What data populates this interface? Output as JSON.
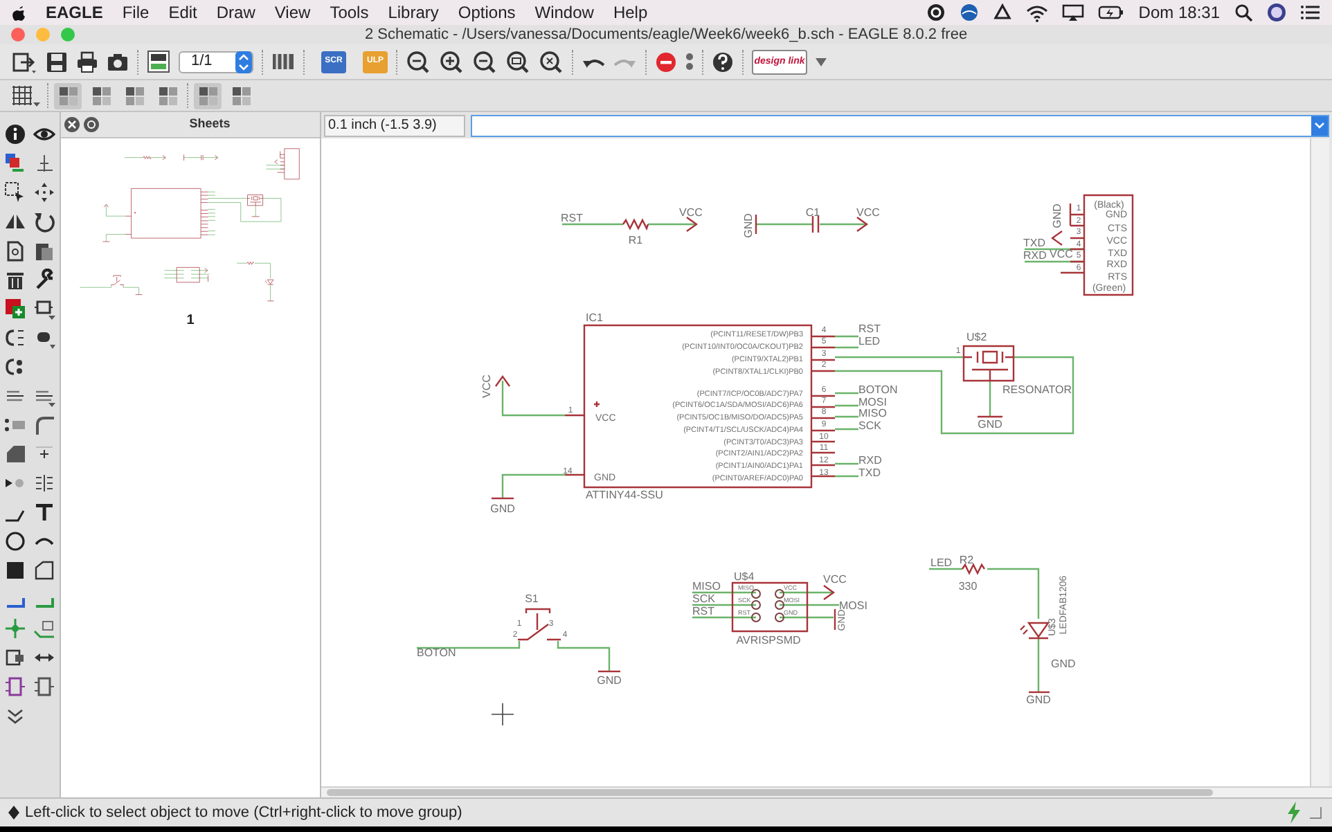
{
  "menubar": {
    "app": "EAGLE",
    "items": [
      "File",
      "Edit",
      "Draw",
      "View",
      "Tools",
      "Library",
      "Options",
      "Window",
      "Help"
    ],
    "clock": "Dom 18:31"
  },
  "window": {
    "title": "2 Schematic - /Users/vanessa/Documents/eagle/Week6/week6_b.sch - EAGLE 8.0.2 free"
  },
  "toolbar": {
    "sheet_select": "1/1",
    "script_label": "SCR",
    "ulp_label": "ULP",
    "logo_text": "design link"
  },
  "sheets_panel": {
    "title": "Sheets",
    "sheet_label": "1"
  },
  "coordinate": "0.1 inch (-1.5 3.9)",
  "schematic": {
    "labels": [
      "RST",
      "R1",
      "VCC",
      "GND",
      "C1",
      "VCC",
      "GND",
      "1",
      "2",
      "3",
      "4",
      "5",
      "6",
      "(Black)",
      "GND",
      "CTS",
      "VCC",
      "TXD",
      "RXD",
      "RTS",
      "(Green)",
      "TXD",
      "RXD",
      "VCC",
      "IC1",
      "(PCINT11/RESET/DW)PB3",
      "(PCINT10/INT0/OC0A/CKOUT)PB2",
      "(PCINT9/XTAL2)PB1",
      "(PCINT8/XTAL1/CLKI)PB0",
      "(PCINT7/ICP/OC0B/ADC7)PA7",
      "(PCINT6/OC1A/SDA/MOSI/ADC6)PA6",
      "(PCINT5/OC1B/MISO/DO/ADC5)PA5",
      "(PCINT4/T1/SCL/USCK/ADC4)PA4",
      "(PCINT3/T0/ADC3)PA3",
      "(PCINT2/AIN1/ADC2)PA2",
      "(PCINT1/AIN0/ADC1)PA1",
      "(PCINT0/AREF/ADC0)PA0",
      "4",
      "5",
      "3",
      "2",
      "6",
      "7",
      "8",
      "9",
      "10",
      "11",
      "12",
      "13",
      "RST",
      "LED",
      "BOTON",
      "MOSI",
      "MISO",
      "SCK",
      "RXD",
      "TXD",
      "VCC",
      "1",
      "GND",
      "14",
      "ATTINY44-SSU",
      "VCC",
      "GND",
      "U$2",
      "1",
      "RESONATOR",
      "GND",
      "S1",
      "1",
      "3",
      "2",
      "4",
      "BOTON",
      "GND",
      "U$4",
      "MISO",
      "SCK",
      "RST",
      "MISO",
      "SCK",
      "RST",
      "VCC",
      "MOSI",
      "GND",
      "AVRISPSMD",
      "VCC",
      "MOSI",
      "GND",
      "LED",
      "R2",
      "330",
      "U$3",
      "LEDFAB1206",
      "GND",
      "GND"
    ]
  },
  "status_bar": "Left-click to select object to move (Ctrl+right-click to move group)"
}
